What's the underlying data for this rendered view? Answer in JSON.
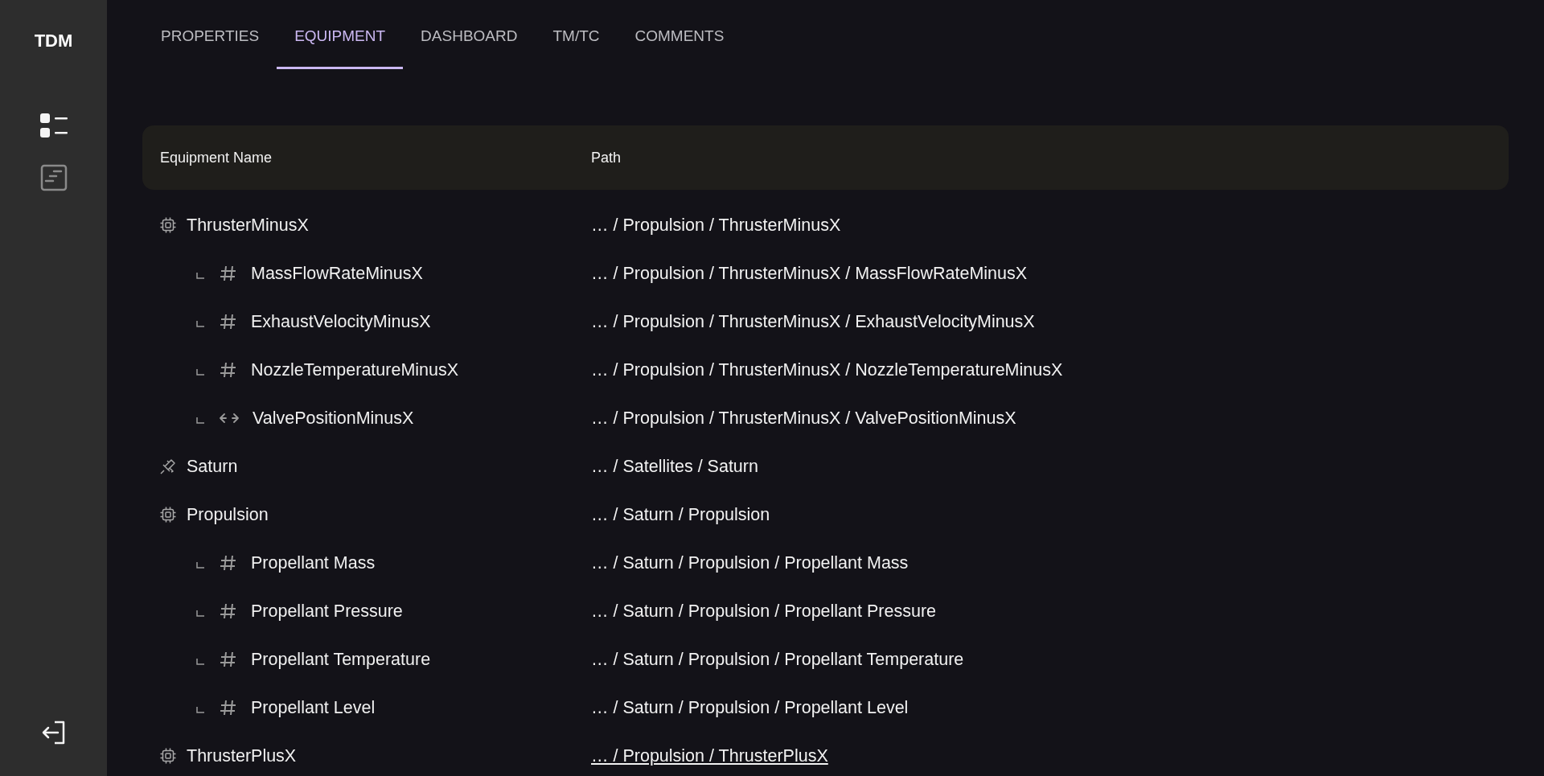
{
  "sidebar": {
    "logo": "TDM",
    "items": [
      {
        "kind": "list",
        "selected": true
      },
      {
        "kind": "document",
        "selected": false
      }
    ]
  },
  "tabs": [
    {
      "label": "PROPERTIES",
      "selected": false
    },
    {
      "label": "EQUIPMENT",
      "selected": true
    },
    {
      "label": "DASHBOARD",
      "selected": false
    },
    {
      "label": "TM/TC",
      "selected": false
    },
    {
      "label": "COMMENTS",
      "selected": false
    }
  ],
  "table": {
    "columns": [
      "Equipment Name",
      "Path"
    ],
    "rows": [
      {
        "kind": "component",
        "name": "ThrusterMinusX",
        "path": "… / Propulsion / ThrusterMinusX",
        "hovered": false,
        "children": [
          {
            "kind": "number",
            "name": "MassFlowRateMinusX",
            "path": "… / Propulsion / ThrusterMinusX / MassFlowRateMinusX"
          },
          {
            "kind": "number",
            "name": "ExhaustVelocityMinusX",
            "path": "… / Propulsion / ThrusterMinusX / ExhaustVelocityMinusX"
          },
          {
            "kind": "number",
            "name": "NozzleTemperatureMinusX",
            "path": "… / Propulsion / ThrusterMinusX / NozzleTemperatureMinusX"
          },
          {
            "kind": "command",
            "name": "ValvePositionMinusX",
            "path": "… / Propulsion / ThrusterMinusX / ValvePositionMinusX"
          }
        ]
      },
      {
        "kind": "satellite",
        "name": "Saturn",
        "path": "… / Satellites / Saturn",
        "hovered": false,
        "children": []
      },
      {
        "kind": "component",
        "name": "Propulsion",
        "path": "… / Saturn / Propulsion",
        "hovered": false,
        "children": [
          {
            "kind": "number",
            "name": "Propellant Mass",
            "path": "… / Saturn / Propulsion / Propellant Mass"
          },
          {
            "kind": "number",
            "name": "Propellant Pressure",
            "path": "… / Saturn / Propulsion / Propellant Pressure"
          },
          {
            "kind": "number",
            "name": "Propellant Temperature",
            "path": "… / Saturn / Propulsion / Propellant Temperature"
          },
          {
            "kind": "number",
            "name": "Propellant Level",
            "path": "… / Saturn / Propulsion / Propellant Level"
          }
        ]
      },
      {
        "kind": "component",
        "name": "ThrusterPlusX",
        "path": "… / Propulsion / ThrusterPlusX",
        "hovered": true,
        "children": []
      }
    ]
  }
}
